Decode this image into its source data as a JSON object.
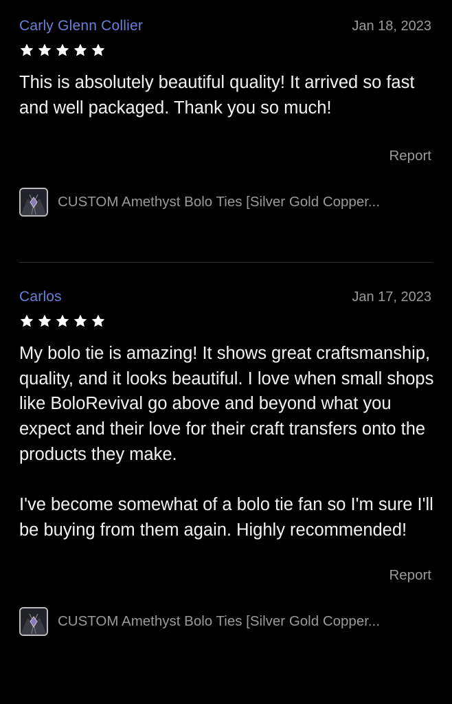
{
  "colors": {
    "background": "#000000",
    "reviewer_name": "#6b7fd7",
    "muted_text": "#9a9a9a",
    "body_text": "#f2f2f2",
    "divider": "#2f2f2f"
  },
  "reviews": [
    {
      "name": "Carly Glenn Collier",
      "date": "Jan 18, 2023",
      "rating": 5,
      "max_rating": 5,
      "text": "This is absolutely beautiful quality! It arrived so fast and well packaged. Thank you so much!",
      "report_label": "Report",
      "product": {
        "title": "CUSTOM Amethyst Bolo Ties [Silver Gold Copper...",
        "thumbnail_icon": "bolo-tie-thumbnail"
      }
    },
    {
      "name": "Carlos",
      "date": "Jan 17, 2023",
      "rating": 5,
      "max_rating": 5,
      "text": "My bolo tie is amazing! It shows great craftsmanship, quality, and it looks beautiful. I love when small shops like BoloRevival go above and beyond what you expect and their love for their craft transfers onto the products they make.\n\nI've become somewhat of a bolo tie fan so I'm sure I'll be buying from them again. Highly recommended!",
      "report_label": "Report",
      "product": {
        "title": "CUSTOM Amethyst Bolo Ties [Silver Gold Copper...",
        "thumbnail_icon": "bolo-tie-thumbnail"
      }
    }
  ]
}
